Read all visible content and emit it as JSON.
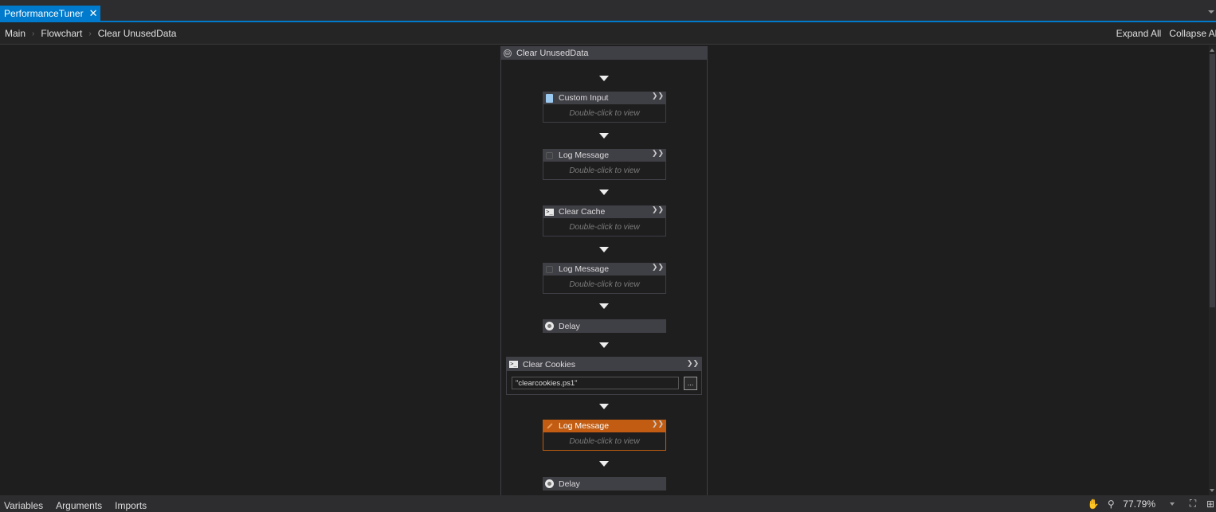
{
  "tab": {
    "title": "PerformanceTuner",
    "close": "✕"
  },
  "breadcrumb": {
    "items": [
      "Main",
      "Flowchart",
      "Clear UnusedData"
    ],
    "separator": "›"
  },
  "toolbar": {
    "expand_all": "Expand All",
    "collapse_all": "Collapse All"
  },
  "sequence": {
    "title": "Clear UnusedData",
    "activities": [
      {
        "title": "Custom Input",
        "hint": "Double-click to view",
        "icon": "document-icon"
      },
      {
        "title": "Log Message",
        "hint": "Double-click to view",
        "icon": "log-icon"
      },
      {
        "title": "Clear Cache",
        "hint": "Double-click to view",
        "icon": "powershell-icon"
      },
      {
        "title": "Log Message",
        "hint": "Double-click to view",
        "icon": "log-icon"
      },
      {
        "title": "Delay",
        "icon": "delay-icon"
      },
      {
        "title": "Clear Cookies",
        "icon": "powershell-icon",
        "input_value": "\"clearcookies.ps1\"",
        "browse": "..."
      },
      {
        "title": "Log Message",
        "hint": "Double-click to view",
        "icon": "pencil-icon",
        "selected": true
      },
      {
        "title": "Delay",
        "icon": "delay-icon"
      }
    ]
  },
  "status": {
    "tabs": [
      "Variables",
      "Arguments",
      "Imports"
    ],
    "zoom": "77.79%"
  },
  "colors": {
    "accent": "#007acc",
    "selected": "#c15c12",
    "background": "#1e1e1e"
  }
}
